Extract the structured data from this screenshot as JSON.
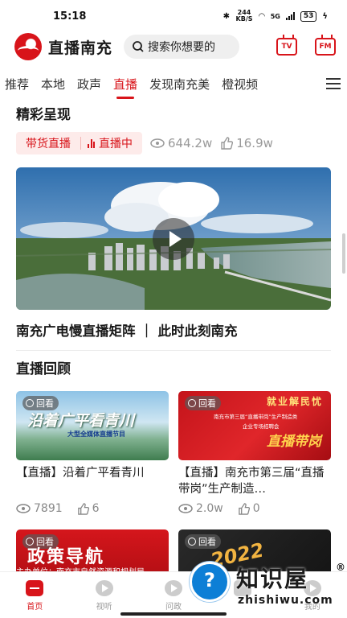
{
  "status_bar": {
    "time": "15:18",
    "net_speed": "244 KB/S",
    "signal": "5G",
    "battery": "53"
  },
  "header": {
    "brand": "直播南充",
    "search_placeholder": "搜索你想要的",
    "tv_label": "TV",
    "radio_label": "FM"
  },
  "nav": {
    "tabs": [
      "推荐",
      "本地",
      "政声",
      "直播",
      "发现南充美",
      "橙视频"
    ],
    "active_index": 3
  },
  "featured": {
    "title": "精彩呈现",
    "tag_category": "带货直播",
    "tag_live": "直播中",
    "views": "644.2w",
    "likes": "16.9w",
    "caption": "南充广电慢直播矩阵 ｜ 此时此刻南充"
  },
  "replays": {
    "title": "直播回顾",
    "badge": "回看",
    "cards": [
      {
        "title": "【直播】沿着广平看青川",
        "views": "7891",
        "likes": "6",
        "thumb_title": "沿着广平看青川",
        "thumb_sub": "大型全媒体直播节目"
      },
      {
        "title": "【直播】南充市第三届“直播带岗”生产制造…",
        "views": "2.0w",
        "likes": "0",
        "thumb_top": "就业解民忧",
        "thumb_mid": "南充市第三届“直播带岗”生产制造类",
        "thumb_mid2": "企业专场招聘会",
        "thumb_big": "直播带岗"
      },
      {
        "thumb_title": "政策导航",
        "thumb_sub": "主办单位：南充市自然资源和规划局"
      },
      {
        "thumb_big": "2022"
      }
    ]
  },
  "bottom_nav": {
    "items": [
      "首页",
      "视听",
      "问政",
      "",
      "我的"
    ],
    "active_index": 0
  },
  "watermark": {
    "cn": "知识屋",
    "en": "zhishiwu.com",
    "reg": "®"
  },
  "colors": {
    "brand_red": "#d8141a",
    "tag_bg": "#fdebea",
    "muted": "#999999"
  }
}
